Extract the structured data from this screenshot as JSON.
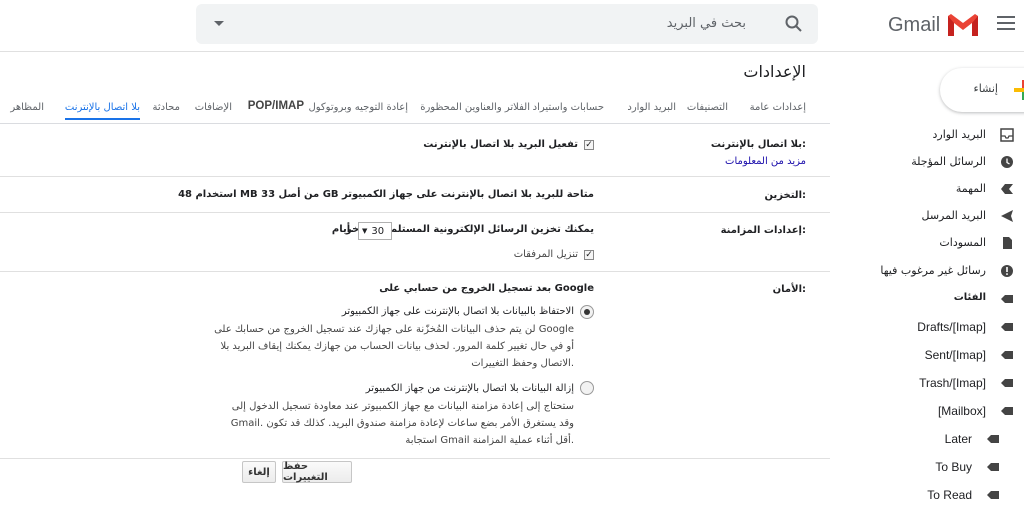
{
  "header": {
    "app_name": "Gmail",
    "search_placeholder": "بحث في البريد"
  },
  "sidebar": {
    "compose_label": "إنشاء",
    "items": [
      {
        "label": "البريد الوارد",
        "icon": "inbox-icon"
      },
      {
        "label": "الرسائل المؤجلة",
        "icon": "clock-icon"
      },
      {
        "label": "المهمة",
        "icon": "important-icon"
      },
      {
        "label": "البريد المرسل",
        "icon": "send-icon"
      },
      {
        "label": "المسودات",
        "icon": "draft-icon"
      },
      {
        "label": "رسائل غير مرغوب فيها",
        "icon": "spam-icon"
      },
      {
        "label": "الفئات",
        "icon": "label-icon"
      },
      {
        "label": "[Imap]/Drafts",
        "icon": "label-icon"
      },
      {
        "label": "[Imap]/Sent",
        "icon": "label-icon"
      },
      {
        "label": "[Imap]/Trash",
        "icon": "label-icon"
      },
      {
        "label": "[Mailbox]",
        "icon": "label-icon"
      },
      {
        "label": "Later",
        "icon": "label-icon"
      },
      {
        "label": "To Buy",
        "icon": "label-icon"
      },
      {
        "label": "To Read",
        "icon": "label-icon"
      }
    ]
  },
  "settings": {
    "title": "الإعدادات",
    "tabs": [
      "إعدادات عامة",
      "التصنيفات",
      "البريد الوارد",
      "حسابات واستيراد",
      "الفلاتر والعناوين المحظورة",
      "إعادة التوجيه وبروتوكول",
      "POP/IMAP",
      "الإضافات",
      "محادثة",
      "بلا اتصال بالإنترنت",
      "المظاهر"
    ],
    "offline": {
      "label": "بلا اتصال بالإنترنت:",
      "learn_more": "مزيد من المعلومات",
      "enable_label": "تفعيل البريد بلا اتصال بالإنترنت",
      "enable_checked": true
    },
    "storage": {
      "label": "التخزين:",
      "text": "استخدام 48 MB من أصل 33 GB متاحة للبريد بلا اتصال بالإنترنت على جهاز الكمبيوتر"
    },
    "sync": {
      "label": "إعدادات المزامنة:",
      "text_before": "يمكنك تخزين الرسائل الإلكترونية المستلمة من آخر",
      "days_value": "30",
      "text_after": "أيام.",
      "download_attachments": "تنزيل المرفقات",
      "download_checked": true
    },
    "security": {
      "label": "الأمان:",
      "heading": "بعد تسجيل الخروج من حسابي على Google",
      "option1_title": "الاحتفاظ بالبيانات بلا اتصال بالإنترنت على جهاز الكمبيوتر",
      "option1_line1": "لن يتم حذف البيانات المُخزّنة على جهازك عند تسجيل الخروج من حسابك على Google",
      "option1_line2": "أو في حال تغيير كلمة المرور. لحذف بيانات الحساب من جهازك يمكنك إيقاف البريد بلا",
      "option1_line3": "الاتصال وحفظ التغييرات.",
      "option1_selected": true,
      "option2_title": "إزالة البيانات بلا اتصال بالإنترنت من جهاز الكمبيوتر",
      "option2_line1": "ستحتاج إلى إعادة مزامنة البيانات مع جهاز الكمبيوتر عند معاودة تسجيل الدخول إلى",
      "option2_line2": "Gmail. وقد يستغرق الأمر بضع ساعات لإعادة مزامنة صندوق البريد. كذلك قد تكون",
      "option2_line3": "استجابة Gmail أقل أثناء عملية المزامنة.",
      "option2_selected": false
    },
    "buttons": {
      "save": "حفظ التغييرات",
      "cancel": "إلغاء"
    }
  },
  "colors": {
    "accent": "#1a73e8",
    "gmail_red": "#ea4335"
  }
}
